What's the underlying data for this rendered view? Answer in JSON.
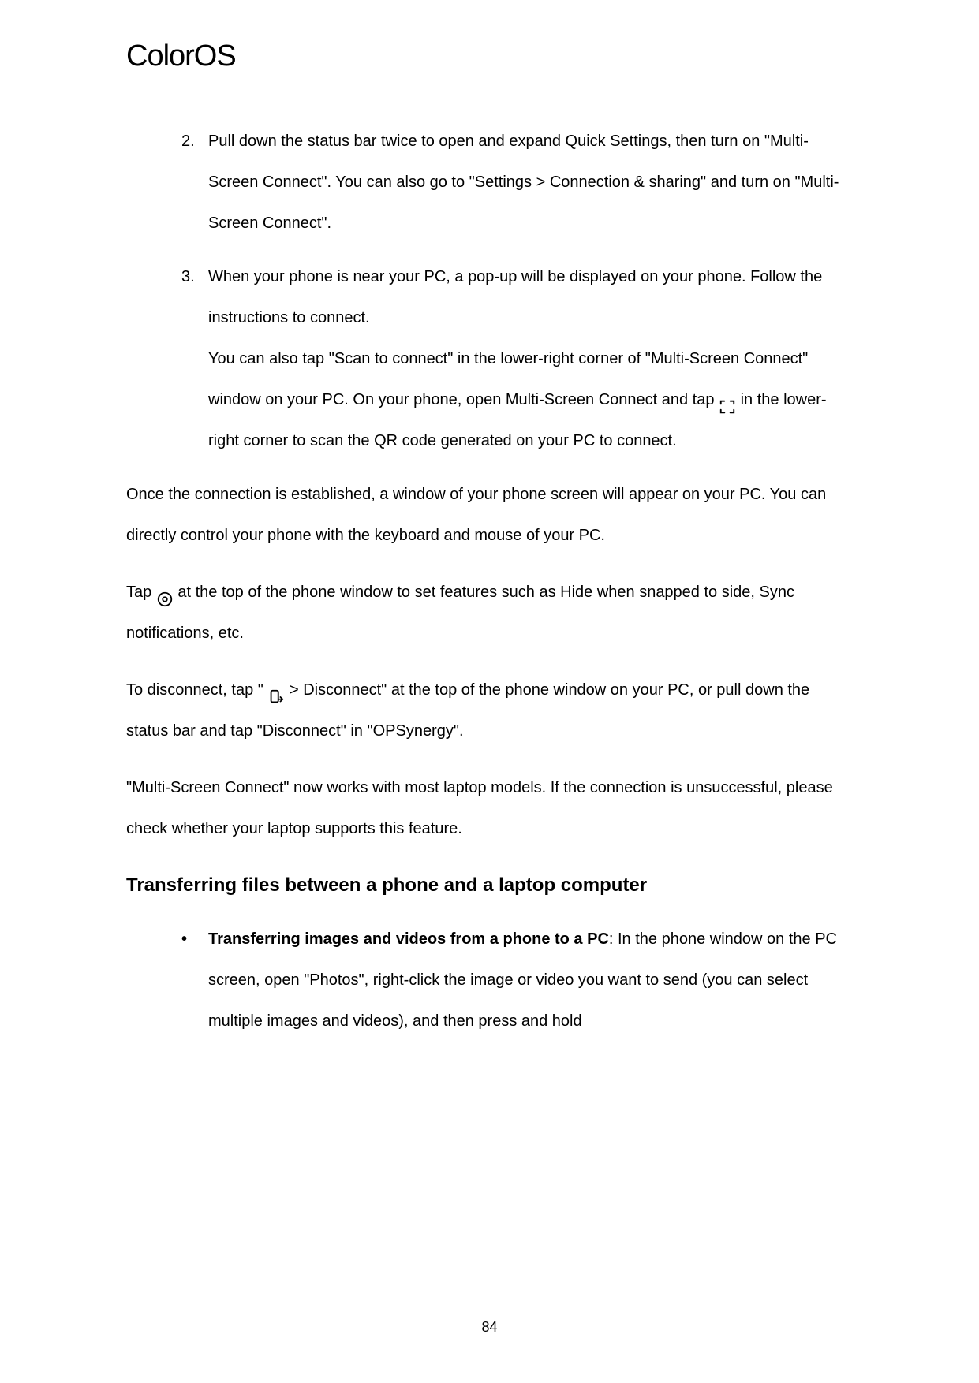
{
  "brand": "ColorOS",
  "list": {
    "item2": {
      "num": "2.",
      "text": "Pull down the status bar twice to open and expand Quick Settings, then turn on \"Multi-Screen Connect\". You can also go to \"Settings > Connection & sharing\" and turn on \"Multi-Screen Connect\"."
    },
    "item3": {
      "num": "3.",
      "para1": "When your phone is near your PC, a pop-up will be displayed on your phone. Follow the instructions to connect.",
      "para2a": "You can also tap \"Scan to connect\" in the lower-right corner of \"Multi-Screen Connect\" window on your PC. On your phone, open Multi-Screen Connect and tap ",
      "para2b": " in the lower-right corner to scan the QR code generated on your PC to connect."
    }
  },
  "body": {
    "p1": "Once the connection is established, a window of your phone screen will appear on your PC. You can directly control your phone with the keyboard and mouse of your PC.",
    "p2a": "Tap ",
    "p2b": " at the top of the phone window to set features such as Hide when snapped to side, Sync notifications, etc.",
    "p3a": "To disconnect, tap \" ",
    "p3b": " > Disconnect\" at the top of the phone window on your PC, or pull down the status bar and tap \"Disconnect\" in \"OPSynergy\".",
    "p4": "\"Multi-Screen Connect\" now works with most laptop models. If the connection is unsuccessful, please check whether your laptop supports this feature."
  },
  "heading": "Transferring files between a phone and a laptop computer",
  "bullet": {
    "mark": "•",
    "bold": "Transferring images and videos from a phone to a PC",
    "rest": ": In the phone window on the PC screen, open \"Photos\", right-click the image or video you want to send (you can select multiple images and videos), and then press and hold"
  },
  "page_number": "84"
}
